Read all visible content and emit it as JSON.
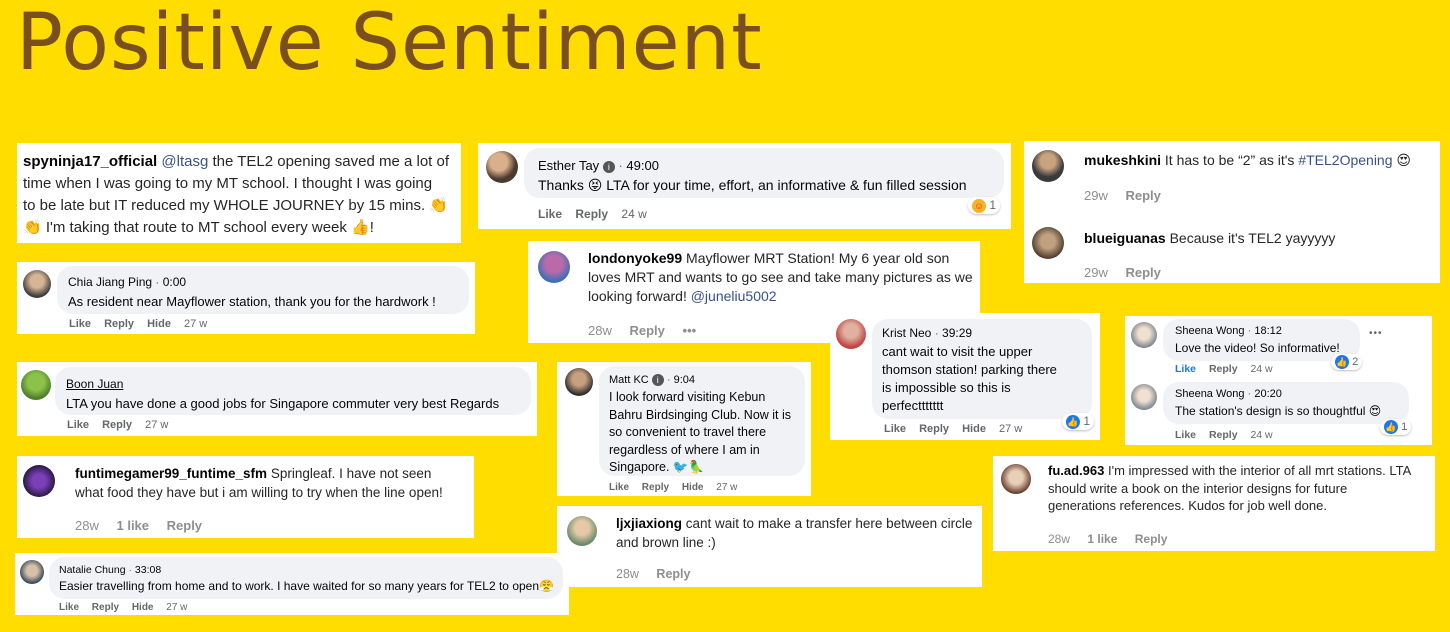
{
  "title": "Positive Sentiment",
  "c1": {
    "user": "spyninja17_official",
    "mention": "@ltasg",
    "line1": " the TEL2 opening saved me a lot of",
    "line2": "time when I was going to my MT school. I thought I was going",
    "line3": "to be late but IT reduced my WHOLE JOURNEY by 15 mins. 👏",
    "line4": "👏 I'm taking that route to MT school every week 👍!"
  },
  "c2": {
    "name": "Esther Tay",
    "time": "49:00",
    "text": "Thanks 😝 LTA for your time, effort, an informative & fun filled session",
    "like": "Like",
    "reply": "Reply",
    "age": "24 w",
    "reactions": "1"
  },
  "c3": {
    "user": "mukeshkini",
    "text_a": " It has to be “2” as it's ",
    "hashtag": "#TEL2Opening",
    "text_b": " 😍",
    "age": "29w",
    "reply": "Reply"
  },
  "c4": {
    "user": "blueiguanas",
    "text": " Because it's TEL2 yayyyyy",
    "age": "29w",
    "reply": "Reply"
  },
  "c5": {
    "name": "Chia Jiang Ping",
    "time": "0:00",
    "text": "As resident near Mayflower station, thank you for the hardwork !",
    "like": "Like",
    "reply": "Reply",
    "hide": "Hide",
    "age": "27 w"
  },
  "c6": {
    "user": "londonyoke99",
    "line1": " Mayflower MRT Station! My 6 year old son",
    "line2": "loves MRT and wants to go see and take many pictures as we",
    "line3a": "looking forward! ",
    "mention": "@juneliu5002",
    "age": "28w",
    "reply": "Reply",
    "more": "•••"
  },
  "c7": {
    "name": "Boon Juan",
    "text": "LTA you have done a good jobs for Singapore commuter very best Regards",
    "like": "Like",
    "reply": "Reply",
    "age": "27 w"
  },
  "c8": {
    "name": "Matt KC",
    "time": "9:04",
    "line1": "I look forward visiting Kebun",
    "line2": "Bahru Birdsinging Club. Now it is",
    "line3": "so convenient to travel there",
    "line4": "regardless of where I am in",
    "line5": "Singapore. 🐦🦜",
    "like": "Like",
    "reply": "Reply",
    "hide": "Hide",
    "age": "27 w"
  },
  "c9": {
    "name": "Krist Neo",
    "time": "39:29",
    "line1": "cant wait to visit the upper",
    "line2": "thomson station! parking there",
    "line3": "is impossible so this is",
    "line4": "perfecttttttt",
    "like": "Like",
    "reply": "Reply",
    "hide": "Hide",
    "age": "27 w",
    "reactions": "1"
  },
  "c10": {
    "a_name": "Sheena Wong",
    "a_time": "18:12",
    "a_text": "Love the video! So informative!",
    "a_reactions": "2",
    "a_like": "Like",
    "a_reply": "Reply",
    "a_age": "24 w",
    "b_name": "Sheena Wong",
    "b_time": "20:20",
    "b_text": "The station's design is so thoughtful 😍",
    "b_reactions": "1",
    "b_like": "Like",
    "b_reply": "Reply",
    "b_age": "24 w",
    "more": "•••"
  },
  "c11": {
    "user": "funtimegamer99_funtime_sfm",
    "line1": " Springleaf. I have not seen",
    "line2": "what food they have but i am willing to try when the line open!",
    "age": "28w",
    "likes": "1 like",
    "reply": "Reply"
  },
  "c12": {
    "user": "fu.ad.963",
    "line1": " I'm impressed with the interior of all mrt stations. LTA",
    "line2": "should write a book on the interior designs for future",
    "line3": "generations references. Kudos for job well done.",
    "age": "28w",
    "likes": "1 like",
    "reply": "Reply"
  },
  "c13": {
    "user": "ljxjiaxiong",
    "line1": " cant wait to make a transfer here between circle",
    "line2": "and brown line :)",
    "age": "28w",
    "reply": "Reply"
  },
  "c14": {
    "name": "Natalie Chung",
    "time": "33:08",
    "text": "Easier travelling from home and to work. I have waited for so many years for TEL2 to open😤",
    "like": "Like",
    "reply": "Reply",
    "hide": "Hide",
    "age": "27 w"
  }
}
